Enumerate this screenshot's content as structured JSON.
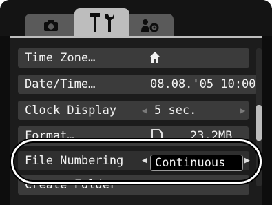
{
  "tabs": [
    {
      "icon": "camera-icon"
    },
    {
      "icon": "wrench-hammer-icon",
      "active": true
    },
    {
      "icon": "person-settings-icon"
    }
  ],
  "menu": {
    "items": [
      {
        "label": "Time Zone…",
        "value_icon": "home-icon"
      },
      {
        "label": "Date/Time…",
        "value": "08.08.'05 10:00"
      },
      {
        "label": "Clock Display",
        "value": "5 sec."
      },
      {
        "label": "Format…",
        "value": "23.2MB",
        "value_icon": "memory-card-icon"
      },
      {
        "label": "File Numbering",
        "value": "Continuous",
        "highlighted": true
      },
      {
        "label": "Create Folder"
      }
    ]
  }
}
